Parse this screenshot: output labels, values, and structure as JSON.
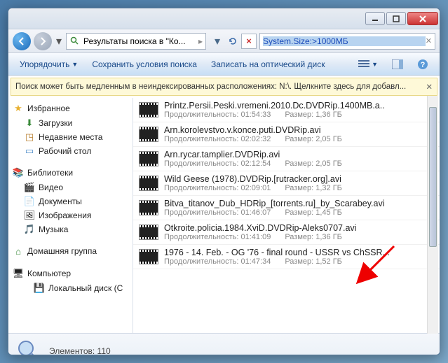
{
  "address": {
    "path": "Результаты поиска в \"Ко..."
  },
  "search": {
    "value": "System.Size:>1000МБ"
  },
  "toolbar": {
    "organize": "Упорядочить",
    "save_search": "Сохранить условия поиска",
    "burn": "Записать на оптический диск"
  },
  "infobar": {
    "text": "Поиск может быть медленным в неиндексированных расположениях: N:\\. Щелкните здесь для добавл..."
  },
  "sidebar": {
    "favorites": {
      "header": "Избранное",
      "downloads": "Загрузки",
      "recent": "Недавние места",
      "desktop": "Рабочий стол"
    },
    "libraries": {
      "header": "Библиотеки",
      "video": "Видео",
      "documents": "Документы",
      "pictures": "Изображения",
      "music": "Музыка"
    },
    "homegroup": "Домашняя группа",
    "computer": {
      "header": "Компьютер",
      "disk": "Локальный диск (C"
    }
  },
  "duration_label": "Продолжительность:",
  "size_label": "Размер:",
  "files": [
    {
      "name": "Printz.Persii.Peski.vremeni.2010.Dc.DVDRip.1400MB.a..",
      "duration": "01:54:33",
      "size": "1,36 ГБ"
    },
    {
      "name": "Arn.korolevstvo.v.konce.puti.DVDRip.avi",
      "duration": "02:02:32",
      "size": "2,05 ГБ"
    },
    {
      "name": "Arn.rycar.tamplier.DVDRip.avi",
      "duration": "02:12:54",
      "size": "2,05 ГБ"
    },
    {
      "name": "Wild Geese (1978).DVDRip.[rutracker.org].avi",
      "duration": "02:09:01",
      "size": "1,32 ГБ"
    },
    {
      "name": "Bitva_titanov_Dub_HDRip_[torrents.ru]_by_Scarabey.avi",
      "duration": "01:46:07",
      "size": "1,45 ГБ"
    },
    {
      "name": "Otkroite.policia.1984.XviD.DVDRip-Aleks0707.avi",
      "duration": "01:41:09",
      "size": "1,36 ГБ"
    },
    {
      "name": "1976 - 14. Feb. - OG '76 - final round - USSR vs ChSSR...",
      "duration": "01:47:34",
      "size": "1,52 ГБ"
    }
  ],
  "status": {
    "elements_label": "Элементов:",
    "count": "110"
  }
}
